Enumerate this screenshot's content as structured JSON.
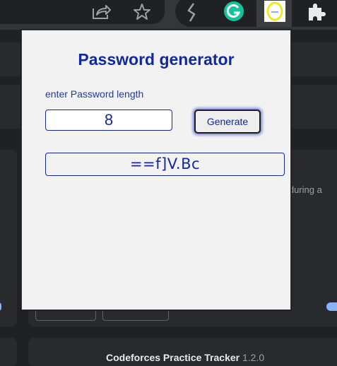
{
  "popup": {
    "title": "Password generator",
    "length_label": "enter Password length",
    "length_value": "8",
    "generate_label": "Generate",
    "password_output": "==f]V.Bc"
  },
  "background": {
    "partial_text": "n during a",
    "card_title": "Codeforces Practice Tracker",
    "card_version": "1.2.0"
  },
  "toolbar": {
    "icons": [
      "share-icon",
      "bookmark-star-icon",
      "extension-s-icon",
      "grammarly-icon",
      "password-generator-extension-icon",
      "extensions-puzzle-icon"
    ]
  },
  "colors": {
    "accent": "#12299a",
    "popup_bg": "#f2f2f2",
    "browser_bg": "#202124",
    "grammarly": "#15c39a"
  }
}
